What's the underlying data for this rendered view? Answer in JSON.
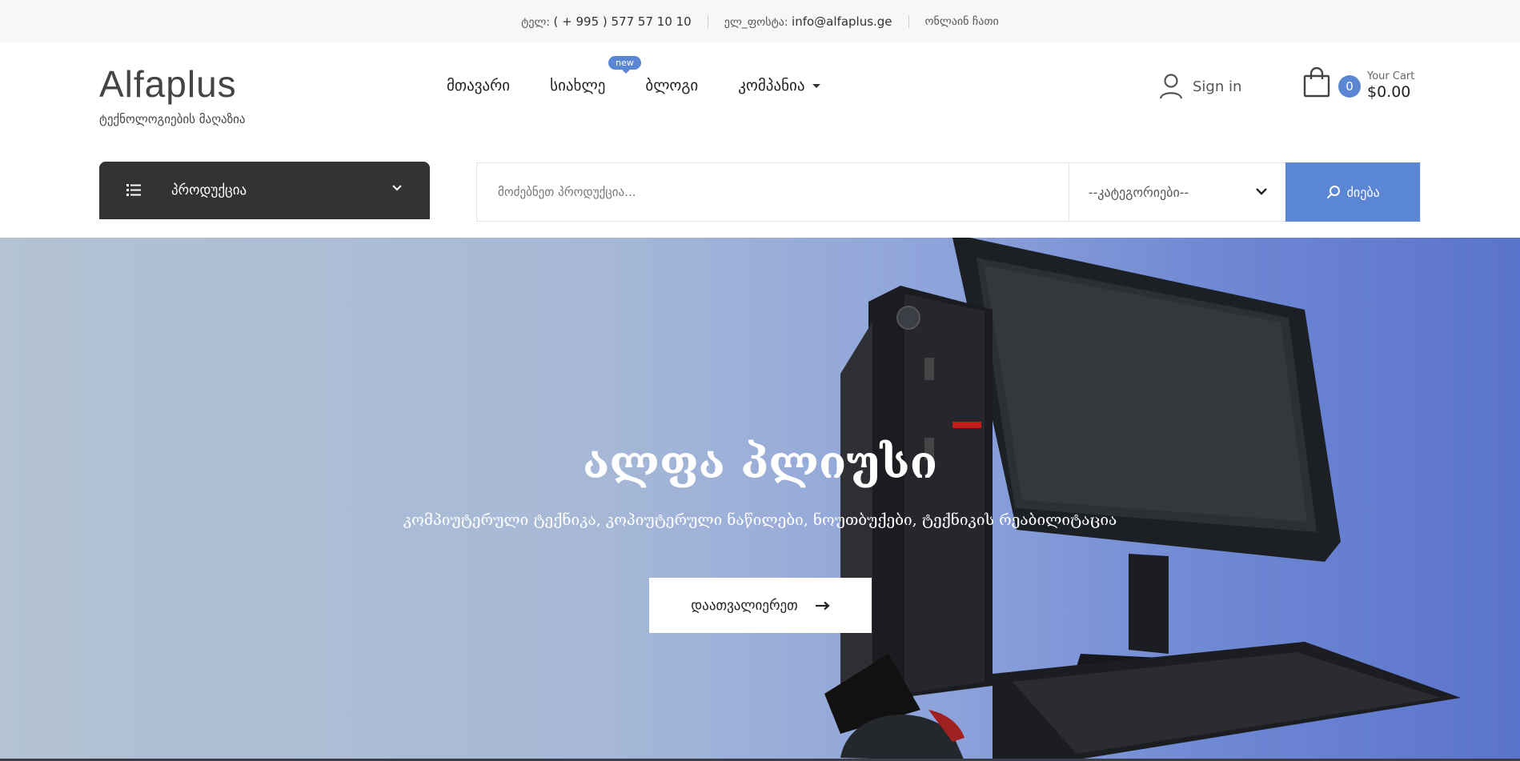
{
  "topbar": {
    "phone_label": "ტელ:",
    "phone": "( + 995 ) 577 57 10 10",
    "email_label": "ელ_ფოსტა:",
    "email": "info@alfaplus.ge",
    "chat": "ონლაინ ჩათი"
  },
  "header": {
    "logo": "Alfaplus",
    "tagline": "ტექნოლოგიების მაღაზია",
    "nav": [
      {
        "label": "მთავარი"
      },
      {
        "label": "სიახლე",
        "badge": "new"
      },
      {
        "label": "ბლოგი"
      },
      {
        "label": "კომპანია"
      }
    ],
    "signin": "Sign in",
    "cart": {
      "count": "0",
      "label": "Your Cart",
      "amount": "$0.00"
    }
  },
  "category_menu": {
    "label": "პროდუქცია"
  },
  "search": {
    "placeholder": "მოძებნეთ პროდუქცია...",
    "category_selected": "--კატეგორიები--",
    "button": "ძიება"
  },
  "hero": {
    "title": "ალფა პლიუსი",
    "subtitle": "კომპიუტერული ტექნიკა, კოპიუტერული ნაწილები, ნოუთბუქები, ტექნიკის რეაბილიტაცია",
    "button": "დაათვალიერეთ"
  },
  "colors": {
    "accent": "#5b86d3",
    "dark": "#333333",
    "topbar_bg": "#f7f7f7"
  }
}
